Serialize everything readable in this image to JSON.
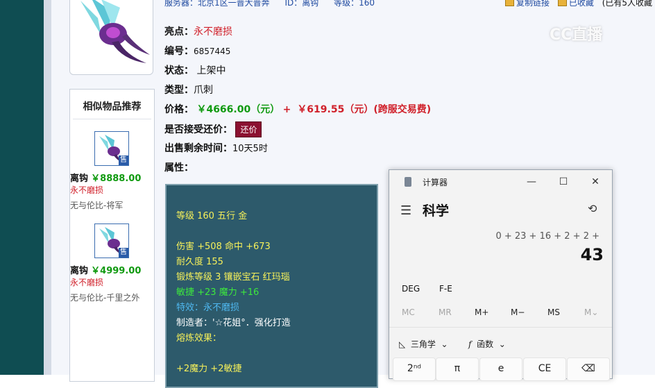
{
  "header": {
    "server": "服务器：北京1区一普大普奔",
    "id": "ID：离钩",
    "level": "等级：160",
    "copy_link": "复制链接",
    "favorited": "已收藏",
    "fav_count": "(已有5人收藏"
  },
  "watermark": "CC直播",
  "item": {
    "highlight_key": "亮点：",
    "highlight_val": "永不磨损",
    "number_key": "编号：",
    "number_val": "6857445",
    "status_key": "状态：",
    "status_val": "上架中",
    "type_key": "类型：",
    "type_val": "爪刺",
    "price_key": "价格：",
    "price_main": "￥4666.00（元）",
    "price_plus": "+",
    "price_fee": "￥619.55（元）(跨服交易费)",
    "bargain_key": "是否接受还价：",
    "bargain_btn": "还价",
    "time_key": "出售剩余时间：",
    "time_val": "10天5时",
    "attr_key": "属性："
  },
  "similar": {
    "title": "相似物品推荐",
    "items": [
      {
        "name": "离钩",
        "price": "￥8888.00",
        "tag": "永不磨损",
        "server": "无与伦比-将军",
        "sale": "售"
      },
      {
        "name": "离钩",
        "price": "￥4999.00",
        "tag": "永不磨损",
        "server": "无与伦比-千里之外",
        "sale": "售"
      }
    ]
  },
  "stats": {
    "line1": "等级 160 五行 金",
    "line2": "伤害 +508 命中 +673",
    "line3": "耐久度 155",
    "line4": "锻炼等级 3 镶嵌宝石 红玛瑙",
    "line5": "敏捷 +23 魔力 +16",
    "line6": "特效：永不磨损",
    "line7": "制造者：'☆花姐°．强化打造",
    "line8": "熔炼效果：",
    "line9": "+2魔力 +2敏捷"
  },
  "calculator": {
    "title": "计算器",
    "mode": "科学",
    "expression": "0 + 23 + 16 + 2 + 2 +",
    "result": "43",
    "deg": "DEG",
    "fe": "F-E",
    "mc": "MC",
    "mr": "MR",
    "mplus": "M+",
    "mminus": "M−",
    "ms": "MS",
    "mv": "M⌄",
    "trig": "三角学",
    "func": "函数",
    "keys": [
      "2ⁿᵈ",
      "π",
      "e",
      "CE",
      "⌫"
    ]
  },
  "colors": {
    "left_bar": "#0f4d52",
    "stats_bg": "#2d5a6b",
    "price_green": "#109a10",
    "accent_red": "#d0202a",
    "bargain_btn": "#8b1030"
  }
}
